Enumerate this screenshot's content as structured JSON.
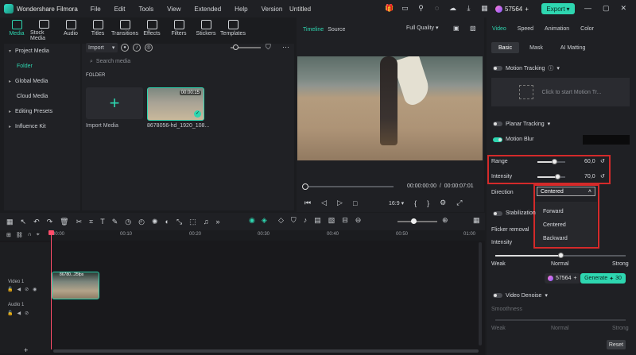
{
  "app": {
    "name": "Wondershare Filmora",
    "window_title": "Untitled",
    "credits": "57564",
    "export_label": "Export"
  },
  "menu": [
    "File",
    "Edit",
    "Tools",
    "View",
    "Extended",
    "Help",
    "Version"
  ],
  "media_tabs": [
    "Media",
    "Stock Media",
    "Audio",
    "Titles",
    "Transitions",
    "Effects",
    "Filters",
    "Stickers",
    "Templates"
  ],
  "sidebar": {
    "items": [
      {
        "label": "Project Media",
        "expanded": true
      },
      {
        "label": "Folder",
        "sub": true
      },
      {
        "label": "Global Media",
        "expanded": false
      },
      {
        "label": "Cloud Media",
        "expanded": false
      },
      {
        "label": "Editing Presets",
        "expanded": false
      },
      {
        "label": "Influence Kit",
        "expanded": false
      }
    ]
  },
  "media": {
    "import_label": "Import",
    "search_placeholder": "Search media",
    "folder_heading": "FOLDER",
    "import_card_label": "Import Media",
    "clip_name": "8678056-hd_1920_108...",
    "clip_duration": "00:00:15"
  },
  "player": {
    "tabs": [
      "Timeline",
      "Source"
    ],
    "quality": "Full Quality",
    "timecode_current": "00:00:00:00",
    "timecode_total": "00:00:07:01",
    "aspect": "16:9"
  },
  "right_panel": {
    "tabs": [
      "Video",
      "Speed",
      "Animation",
      "Color"
    ],
    "subtabs": [
      "Basic",
      "Mask",
      "AI Matting"
    ],
    "motion_tracking": "Motion Tracking",
    "track_hint": "Click to start Motion Tr...",
    "planar_tracking": "Planar Tracking",
    "motion_blur": "Motion Blur",
    "range_label": "Range",
    "range_value": "60,0",
    "range_level": 0.6,
    "intensity_label": "Intensity",
    "intensity_value": "70,0",
    "intensity_level": 0.7,
    "direction_label": "Direction",
    "direction_value": "Centered",
    "direction_options": [
      "Forward",
      "Centered",
      "Backward"
    ],
    "stabilization": "Stabilization",
    "flicker_removal": "Flicker removal",
    "flicker_intensity_label": "Intensity",
    "scale_labels": [
      "Weak",
      "Normal",
      "Strong"
    ],
    "flicker_level": 0.5,
    "generate_credits": "57564",
    "generate_label": "Generate",
    "generate_cost": "30",
    "video_denoise": "Video Denoise",
    "smoothness": "Smoothness",
    "reset_label": "Reset"
  },
  "timeline": {
    "ruler": [
      "00:00",
      "00:10",
      "00:20",
      "00:30",
      "00:40",
      "00:50",
      "01:00"
    ],
    "tracks": [
      {
        "label": "Video 1"
      },
      {
        "label": "Audio 1"
      }
    ],
    "clip_label": "86780...25fps"
  },
  "colors": {
    "accent": "#2ed6b0",
    "highlight": "#d42a2a",
    "playhead": "#ff4d6a"
  }
}
